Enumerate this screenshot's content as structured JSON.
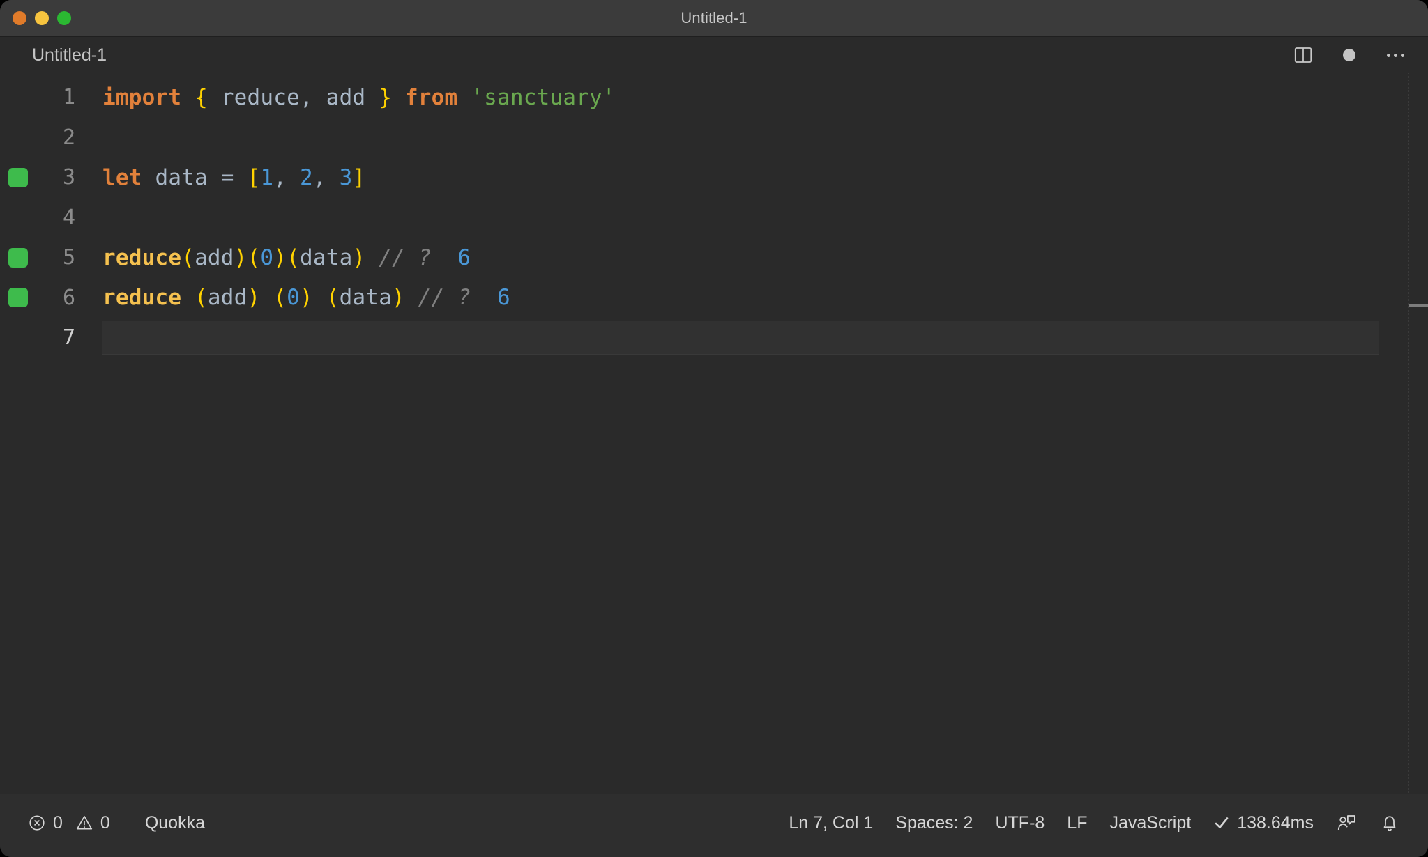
{
  "window": {
    "title": "Untitled-1",
    "traffic_lights": [
      "close",
      "minimize",
      "maximize"
    ]
  },
  "tabbar": {
    "tab_label": "Untitled-1",
    "split_editor_icon": "split-editor-icon",
    "dirty_indicator": "unsaved-dot-icon",
    "more_actions_icon": "ellipsis-icon"
  },
  "editor": {
    "language": "JavaScript",
    "active_line": 7,
    "lines": [
      {
        "number": "1",
        "marker": false,
        "tokens": [
          {
            "c": "t-kw",
            "t": "import"
          },
          {
            "c": "t-op",
            "t": " "
          },
          {
            "c": "t-punct",
            "t": "{"
          },
          {
            "c": "t-ident",
            "t": " reduce"
          },
          {
            "c": "t-op",
            "t": ","
          },
          {
            "c": "t-ident",
            "t": " add "
          },
          {
            "c": "t-punct",
            "t": "}"
          },
          {
            "c": "t-op",
            "t": " "
          },
          {
            "c": "t-kw",
            "t": "from"
          },
          {
            "c": "t-op",
            "t": " "
          },
          {
            "c": "t-str",
            "t": "'sanctuary'"
          }
        ]
      },
      {
        "number": "2",
        "marker": false,
        "tokens": []
      },
      {
        "number": "3",
        "marker": true,
        "tokens": [
          {
            "c": "t-kw",
            "t": "let"
          },
          {
            "c": "t-ident",
            "t": " data "
          },
          {
            "c": "t-op",
            "t": "="
          },
          {
            "c": "t-op",
            "t": " "
          },
          {
            "c": "t-punct",
            "t": "["
          },
          {
            "c": "t-num",
            "t": "1"
          },
          {
            "c": "t-op",
            "t": ", "
          },
          {
            "c": "t-num",
            "t": "2"
          },
          {
            "c": "t-op",
            "t": ", "
          },
          {
            "c": "t-num",
            "t": "3"
          },
          {
            "c": "t-punct",
            "t": "]"
          }
        ]
      },
      {
        "number": "4",
        "marker": false,
        "tokens": []
      },
      {
        "number": "5",
        "marker": true,
        "tokens": [
          {
            "c": "t-fn",
            "t": "reduce"
          },
          {
            "c": "t-punct",
            "t": "("
          },
          {
            "c": "t-ident",
            "t": "add"
          },
          {
            "c": "t-punct",
            "t": ")("
          },
          {
            "c": "t-num",
            "t": "0"
          },
          {
            "c": "t-punct",
            "t": ")("
          },
          {
            "c": "t-ident",
            "t": "data"
          },
          {
            "c": "t-punct",
            "t": ")"
          },
          {
            "c": "t-comment",
            "t": " // ?"
          },
          {
            "c": "t-quokka",
            "t": "  6"
          }
        ]
      },
      {
        "number": "6",
        "marker": true,
        "tokens": [
          {
            "c": "t-fn",
            "t": "reduce"
          },
          {
            "c": "t-punct",
            "t": " ("
          },
          {
            "c": "t-ident",
            "t": "add"
          },
          {
            "c": "t-punct",
            "t": ") ("
          },
          {
            "c": "t-num",
            "t": "0"
          },
          {
            "c": "t-punct",
            "t": ") ("
          },
          {
            "c": "t-ident",
            "t": "data"
          },
          {
            "c": "t-punct",
            "t": ")"
          },
          {
            "c": "t-comment",
            "t": " // ?"
          },
          {
            "c": "t-quokka",
            "t": "  6"
          }
        ]
      },
      {
        "number": "7",
        "marker": false,
        "tokens": [],
        "active": true
      }
    ]
  },
  "statusbar": {
    "errors_icon": "error-circle-icon",
    "errors_count": "0",
    "warnings_icon": "warning-triangle-icon",
    "warnings_count": "0",
    "quokka_label": "Quokka",
    "cursor_position": "Ln 7, Col 1",
    "indentation": "Spaces: 2",
    "encoding": "UTF-8",
    "eol": "LF",
    "language": "JavaScript",
    "run_status_icon": "check-icon",
    "run_time": "138.64ms",
    "feedback_icon": "feedback-person-icon",
    "notifications_icon": "bell-icon"
  },
  "colors": {
    "titlebar_bg": "#3b3b3b",
    "editor_bg": "#2a2a2a",
    "statusbar_bg": "#2e2e2e",
    "quokka_marker_green": "#3ebb4c",
    "keyword_orange": "#e2813b",
    "punct_yellow": "#ffd200",
    "string_green": "#6aa84f",
    "number_blue": "#4a97d6",
    "function_gold": "#f5c14f",
    "identifier_gray": "#a9b7c6",
    "comment_gray": "#808080"
  }
}
